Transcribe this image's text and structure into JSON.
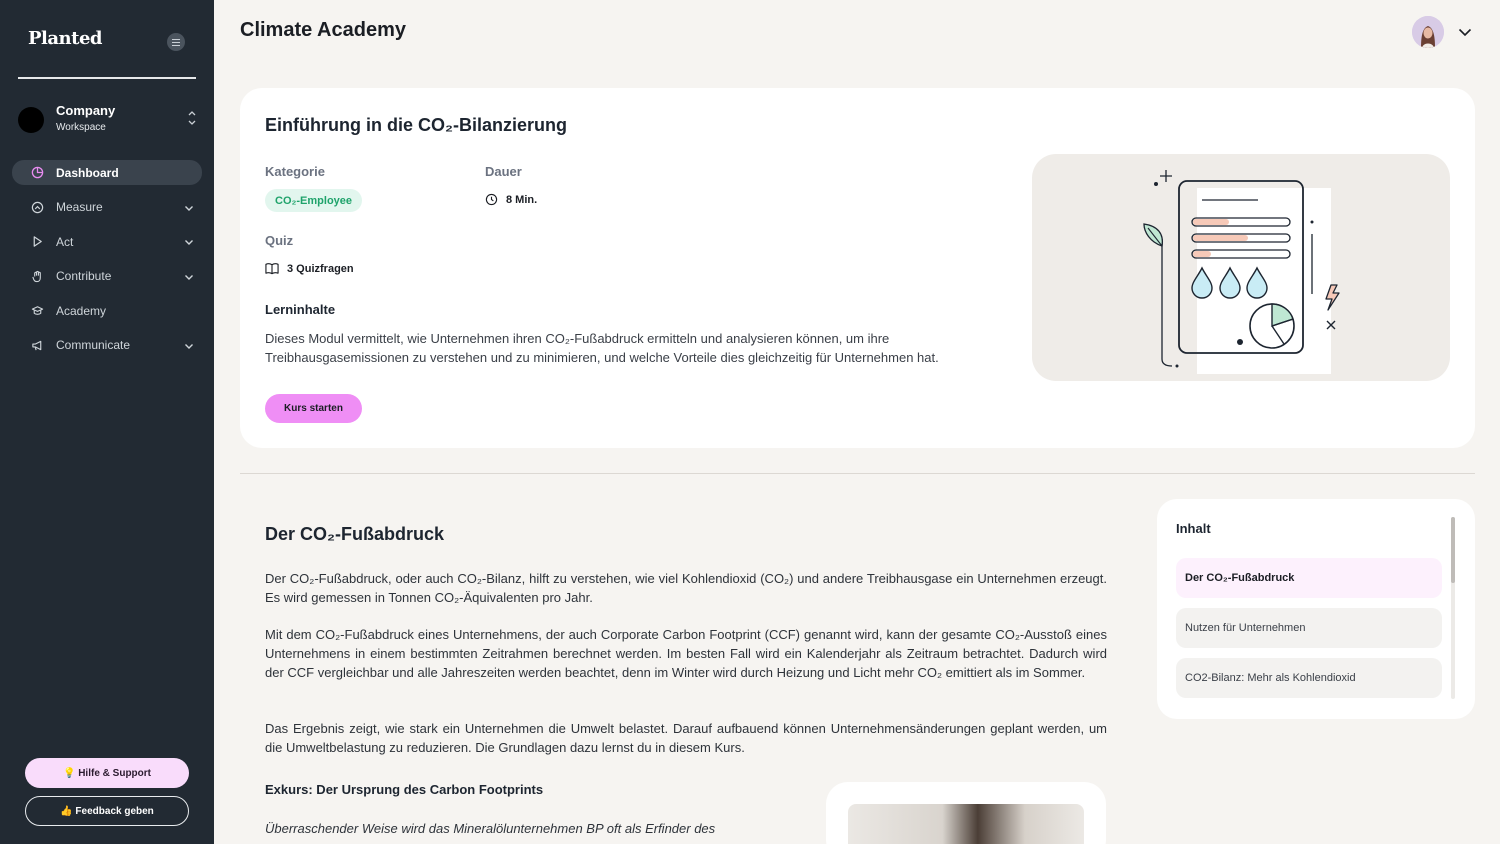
{
  "sidebar": {
    "logo": "Planted",
    "workspace": {
      "name": "Company",
      "sub": "Workspace"
    },
    "items": [
      {
        "label": "Dashboard"
      },
      {
        "label": "Measure"
      },
      {
        "label": "Act"
      },
      {
        "label": "Contribute"
      },
      {
        "label": "Academy"
      },
      {
        "label": "Communicate"
      }
    ],
    "help_label": "💡 Hilfe & Support",
    "feedback_label": "👍 Feedback geben"
  },
  "header": {
    "title": "Climate Academy"
  },
  "course": {
    "title": "Einführung in die CO₂-Bilanzierung",
    "category_label": "Kategorie",
    "category_value": "CO₂-Employee",
    "duration_label": "Dauer",
    "duration_value": "8 Min.",
    "quiz_label": "Quiz",
    "quiz_value": "3 Quizfragen",
    "learn_title": "Lerninhalte",
    "learn_text": "Dieses Modul vermittelt, wie Unternehmen ihren CO₂-Fußabdruck ermitteln und analysieren können, um ihre Treibhausgasemissionen zu verstehen und zu minimieren, und welche Vorteile dies gleichzeitig für Unternehmen hat.",
    "start_label": "Kurs starten"
  },
  "article": {
    "title": "Der CO₂-Fußabdruck",
    "p1": "Der CO₂-Fußabdruck, oder auch CO₂-Bilanz, hilft zu verstehen, wie viel Kohlendioxid (CO₂) und andere Treibhausgase ein Unternehmen erzeugt. Es wird gemessen in Tonnen CO₂-Äquivalenten pro Jahr.",
    "p2": "Mit dem CO₂-Fußabdruck eines Unternehmens, der auch Corporate Carbon Footprint (CCF) genannt wird, kann der gesamte CO₂-Ausstoß eines Unternehmens in einem bestimmten Zeitrahmen berechnet werden. Im besten Fall wird ein Kalenderjahr als Zeitraum betrachtet. Dadurch wird der CCF vergleichbar und alle Jahreszeiten werden beachtet, denn im Winter wird durch Heizung und Licht mehr CO₂ emittiert als im Sommer.",
    "p3": "Das Ergebnis zeigt, wie stark ein Unternehmen die Umwelt belastet. Darauf aufbauend können Unternehmensänderungen geplant werden, um die Umweltbelastung zu reduzieren. Die Grundlagen dazu lernst du in diesem Kurs.",
    "exkurs_title": "Exkurs: Der Ursprung des Carbon Footprints",
    "exkurs_text": "Überraschender Weise wird das Mineralölunternehmen BP oft als Erfinder des"
  },
  "toc": {
    "title": "Inhalt",
    "items": [
      {
        "label": "Der CO₂-Fußabdruck"
      },
      {
        "label": "Nutzen für Unternehmen"
      },
      {
        "label": "CO2-Bilanz: Mehr als Kohlendioxid"
      }
    ]
  }
}
